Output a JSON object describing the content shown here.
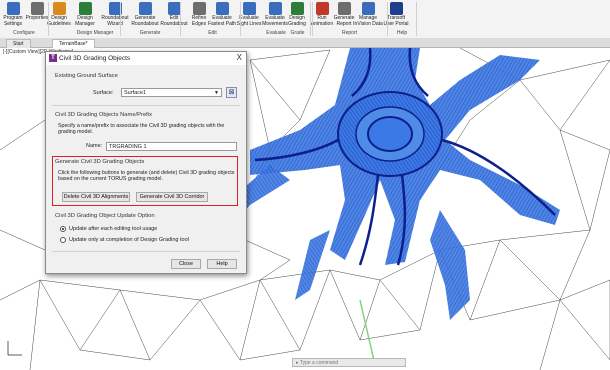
{
  "ribbon": {
    "buttons": [
      {
        "label": "Program Settings",
        "color": "#3b6dbf"
      },
      {
        "label": "Properties",
        "color": "#6d6d6d"
      },
      {
        "label": "Design Guidelines",
        "color": "#d98a1e"
      },
      {
        "label": "Design Manager",
        "color": "#2f7d3a"
      },
      {
        "label": "Roundabout Wizard",
        "color": "#3b6dbf"
      },
      {
        "label": "Generate Roundabout",
        "color": "#3b6dbf"
      },
      {
        "label": "Edit Roundabout",
        "color": "#3b6dbf"
      },
      {
        "label": "Refine Edges",
        "color": "#6d6d6d"
      },
      {
        "label": "Evaluate Fastest Path",
        "color": "#3b6dbf"
      },
      {
        "label": "Evaluate Sight Lines",
        "color": "#3b6dbf"
      },
      {
        "label": "Evaluate Movements",
        "color": "#3b6dbf"
      },
      {
        "label": "Design Grading",
        "color": "#2f7d3a"
      },
      {
        "label": "Run Animation",
        "color": "#c0392b"
      },
      {
        "label": "Generate Report",
        "color": "#6d6d6d"
      },
      {
        "label": "Manage InVision Data",
        "color": "#3b6dbf"
      },
      {
        "label": "Transoft User Portal",
        "color": "#1f3d8f"
      }
    ],
    "panels": [
      "Configure",
      "Design Manager",
      "Generate",
      "Edit",
      "Evaluate",
      "Grade",
      "Report",
      "Help"
    ]
  },
  "doc_tabs": {
    "start": "Start",
    "drawing": "TerrainBase*"
  },
  "viewport": {
    "label": "[-][Custom View][2D Wireframe]"
  },
  "dialog": {
    "title": "Civil 3D Grading Objects",
    "close": "X",
    "existing_ground": {
      "header": "Existing Ground Surface",
      "surface_label": "Surface:",
      "surface_value": "Surface1"
    },
    "name_prefix": {
      "header": "Civil 3D Grading Objects Name/Prefix",
      "description": "Specify a name/prefix to associate the Civil 3D grading objects with the grading model.",
      "name_label": "Name:",
      "name_value": "TRGRADING 1"
    },
    "generate": {
      "header": "Generate Civil 3D Grading Objects",
      "description": "Click the following buttons to generate (and delete) Civil 3D grading objects based on the current TORUS grading model.",
      "delete_button": "Delete Civil 3D Alignments",
      "corridor_button": "Generate Civil 3D Corridor"
    },
    "update_option": {
      "header": "Civil 3D Grading Object Update Option",
      "option1": "Update after each editing tool usage",
      "option2": "Update only at completion of Design Grading tool",
      "selected": "option1"
    },
    "close_button": "Close",
    "help_button": "Help"
  },
  "command_line": {
    "placeholder": "Type a command"
  },
  "colors": {
    "accent_red": "#d9212c",
    "grading_blue": "#2f6fe0",
    "road_dark": "#0d1f8a"
  }
}
